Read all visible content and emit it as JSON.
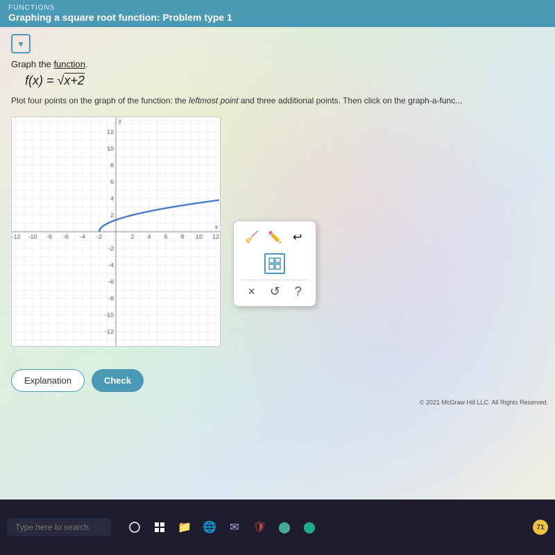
{
  "header": {
    "category": "FUNCTIONS",
    "title": "Graphing a square root function: Problem type 1"
  },
  "content": {
    "instruction": "Graph the function.",
    "function_label": "f(x) = √x+2",
    "plot_instruction": "Plot four points on the graph of the function: the leftmost point and three additional points. Then click on the graph-a-func...",
    "chevron_label": "▾"
  },
  "toolbar": {
    "eraser_label": "⌫",
    "pencil_label": "✏",
    "curve_label": "↩",
    "grid_label": "⊞",
    "x_label": "×",
    "undo_label": "↺",
    "help_label": "?"
  },
  "buttons": {
    "explanation_label": "Explanation",
    "check_label": "Check"
  },
  "copyright": "© 2021 McGraw Hill LLC. All Rights Reserved.",
  "taskbar": {
    "search_placeholder": "Type here to search",
    "time_badge": "71"
  },
  "colors": {
    "header_bg": "#4a9ab5",
    "check_btn_bg": "#4a9ab5",
    "grid_border": "#4a9ab5"
  }
}
